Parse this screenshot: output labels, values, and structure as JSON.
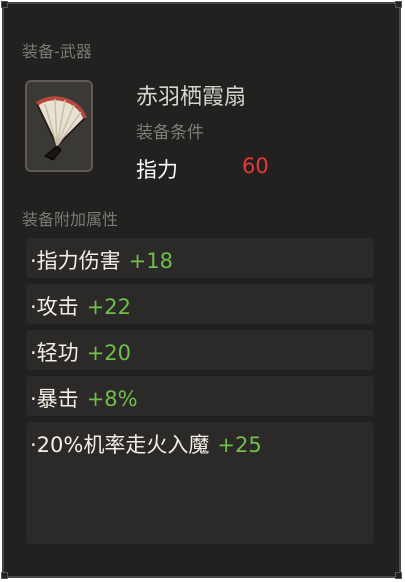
{
  "header": {
    "section_title": "装备-武器"
  },
  "item": {
    "name": "赤羽栖霞扇",
    "requirement_label": "装备条件",
    "requirement": {
      "stat": "指力",
      "value": "60"
    },
    "icon": "folding-fan-icon"
  },
  "attributes": {
    "section_title": "装备附加属性",
    "rows": [
      {
        "name": "·指力伤害",
        "value": "+18"
      },
      {
        "name": "·攻击",
        "value": "+22"
      },
      {
        "name": "·轻功",
        "value": "+20"
      },
      {
        "name": "·暴击",
        "value": "+8%"
      },
      {
        "name": "·20%机率走火入魔",
        "value": "+25"
      }
    ]
  },
  "colors": {
    "panel_bg": "#222120",
    "row_bg": "#2b2a28",
    "value_green": "#6fbf4a",
    "requirement_red": "#e33a3a"
  }
}
